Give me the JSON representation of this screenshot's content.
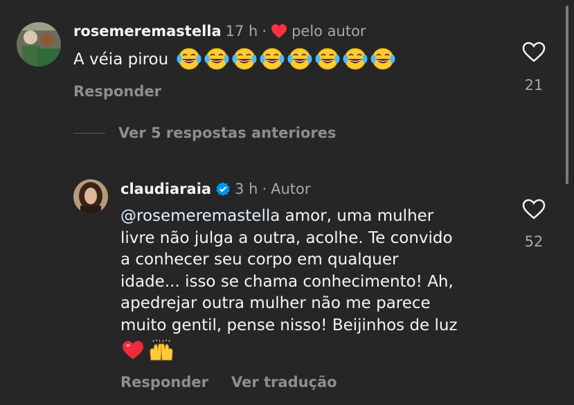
{
  "comment": {
    "username": "rosemeremastella",
    "time": "17 h",
    "dot": "·",
    "liked_by_author_label": "pelo autor",
    "text": "A véia pirou",
    "emoji_count": 8,
    "reply_label": "Responder",
    "likes": "21",
    "colors": {
      "heart": "#ff3040"
    }
  },
  "view_replies": {
    "label": "Ver 5 respostas anteriores"
  },
  "reply": {
    "username": "claudiaraia",
    "time": "3 h",
    "dot": "·",
    "author_label": "Autor",
    "mention": "@rosemeremastella",
    "text_1": " amor, uma mulher",
    "text_2": "livre não julga a outra, acolhe. Te convido",
    "text_3": "a conhecer seu corpo em qualquer",
    "text_4": "idade... isso se chama conhecimento! Ah,",
    "text_5": "apedrejar outra mulher não me parece",
    "text_6": "muito gentil, pense nisso! Beijinhos de luz",
    "reply_label": "Responder",
    "translate_label": "Ver tradução",
    "likes": "52",
    "colors": {
      "verified": "#0095f6"
    }
  },
  "icons": {
    "like": "heart-outline-icon",
    "verified": "verified-badge-icon",
    "emoji_laugh": "face-with-tears-of-joy-icon",
    "emoji_heart": "red-heart-icon",
    "emoji_hands": "raising-hands-icon"
  }
}
